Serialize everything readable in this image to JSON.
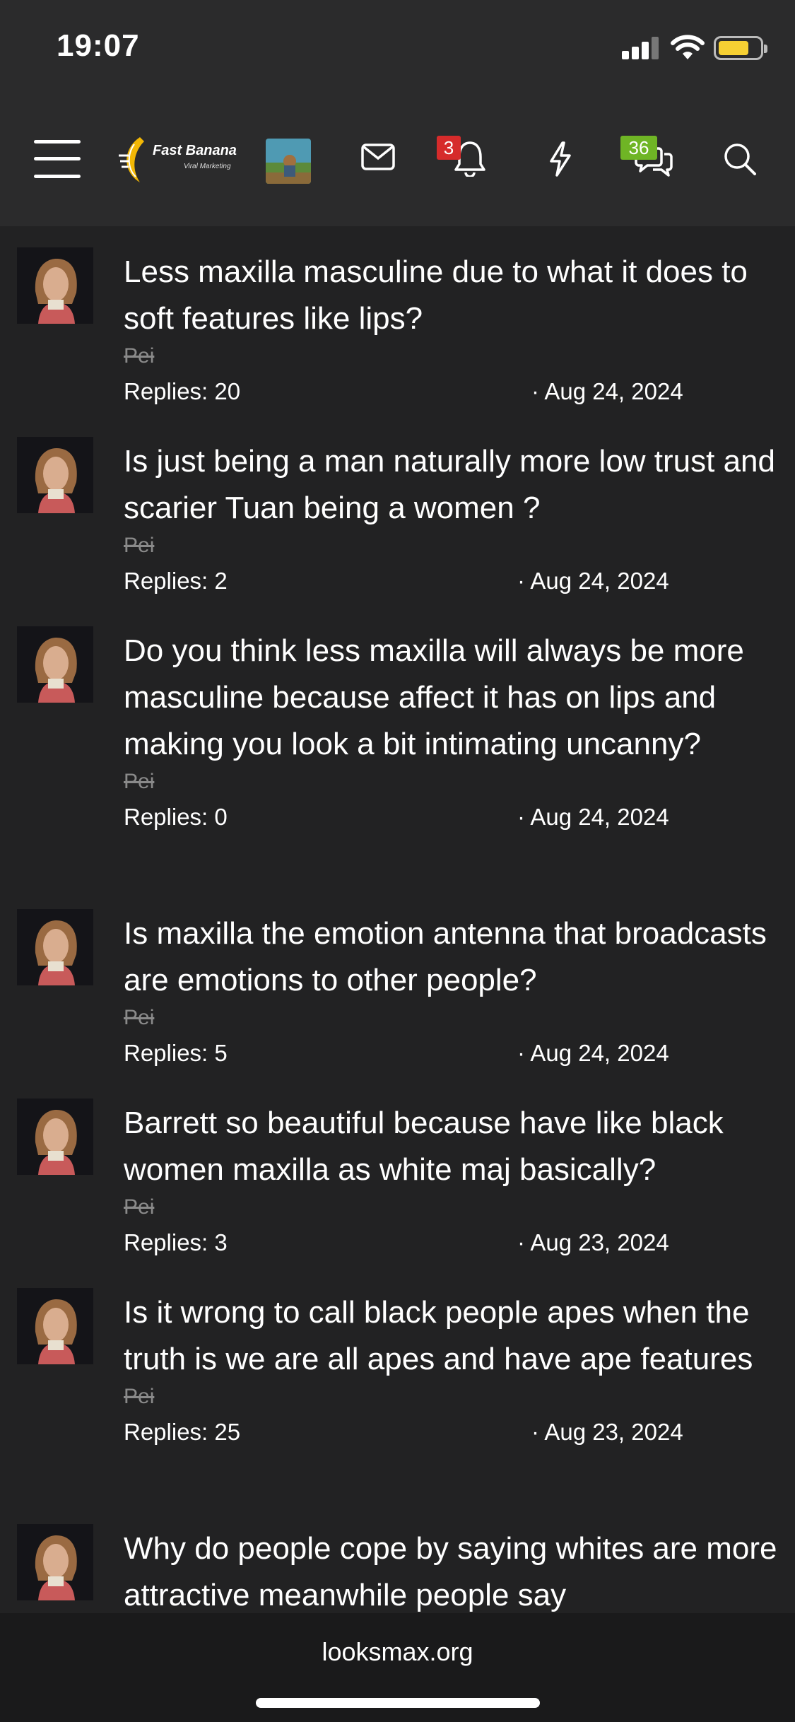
{
  "status_bar": {
    "time": "19:07"
  },
  "nav": {
    "logo_text": "Fast Banana",
    "logo_subtext": "Viral Marketing",
    "alerts_badge": "3",
    "conversations_badge": "36",
    "icons": [
      "menu-icon",
      "mail-icon",
      "bell-icon",
      "lightning-icon",
      "chat-icon",
      "search-icon"
    ],
    "colors": {
      "alert_badge": "#d62b2b",
      "conversation_badge": "#6fb525",
      "background": "#2b2b2c"
    }
  },
  "threads": [
    {
      "title": "Less maxilla masculine due to what it does to soft features like lips?",
      "author": "Pei",
      "replies": "Replies: 20",
      "date": "· Aug 24, 2024"
    },
    {
      "title": "Is just being a man naturally more low trust and scarier Tuan being a women ?",
      "author": "Pei",
      "replies": "Replies: 2",
      "date": "· Aug 24, 2024"
    },
    {
      "title": "Do you think less maxilla will always be more masculine because affect it has on lips and making you look a bit intimating uncanny?",
      "author": "Pei",
      "replies": "Replies: 0",
      "date": "· Aug 24, 2024"
    },
    {
      "title": "Is maxilla the emotion antenna that broadcasts are emotions to other people?",
      "author": "Pei",
      "replies": "Replies: 5",
      "date": "· Aug 24, 2024"
    },
    {
      "title": "Barrett so beautiful because have like black women maxilla as white maj basically?",
      "author": "Pei",
      "replies": "Replies: 3",
      "date": "· Aug 23, 2024"
    },
    {
      "title": "Is it wrong to call black people apes when the truth is we are all apes and have ape features",
      "author": "Pei",
      "replies": "Replies: 25",
      "date": "· Aug 23, 2024"
    },
    {
      "title": "Why do people cope by saying whites are more attractive meanwhile people say",
      "author": "",
      "replies": "",
      "date": ""
    }
  ],
  "footer": {
    "url": "looksmax.org"
  }
}
